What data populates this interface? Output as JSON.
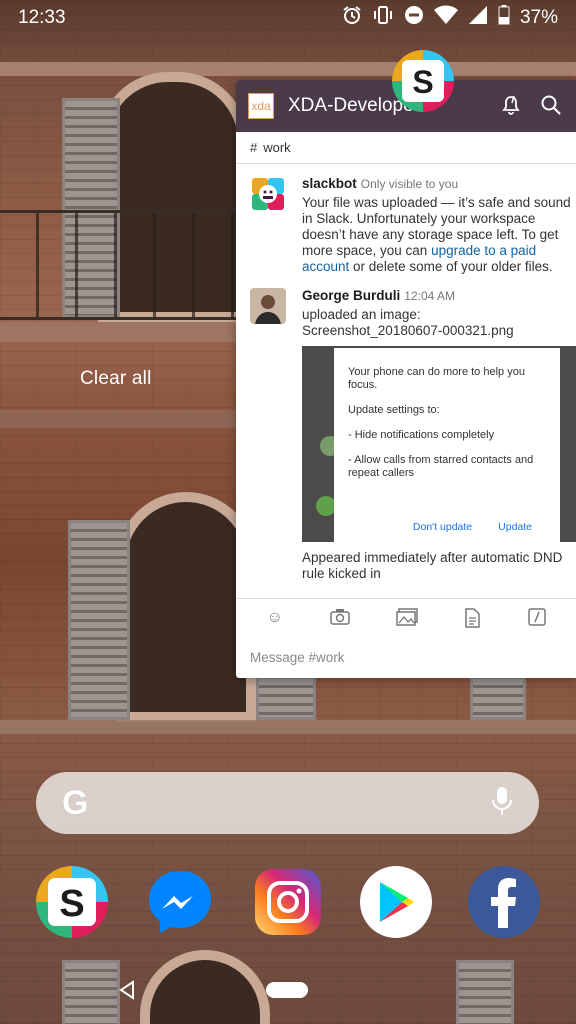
{
  "status_bar": {
    "time": "12:33",
    "battery": "37%",
    "icons": [
      "alarm-icon",
      "vibrate-icon",
      "dnd-icon",
      "wifi-icon",
      "signal-icon",
      "battery-icon"
    ]
  },
  "recents": {
    "clear_all_label": "Clear all"
  },
  "slack_card": {
    "workspace_logo": "xda",
    "workspace_name": "XDA-Developers",
    "channel": "work",
    "messages": [
      {
        "author": "slackbot",
        "meta": "Only visible to you",
        "text_before_link": "Your file was uploaded — it’s safe and sound in Slack. Unfortunately your workspace doesn’t have any storage space left. To get more space, you can ",
        "link": "upgrade to a paid account",
        "text_after_link": " or delete some of your older files."
      },
      {
        "author": "George Burduli",
        "time": "12:04 AM",
        "line1": "uploaded an image:",
        "filename": "Screenshot_20180607-000321.png",
        "caption": "Appeared immediately after automatic DND rule kicked in"
      }
    ],
    "screenshot_dialog": {
      "text1": "Your phone can do more to help you focus.",
      "text2": "Update settings to:",
      "text3": "- Hide notifications completely",
      "text4": "- Allow calls from starred contacts and repeat callers",
      "btn_dont": "Don't update",
      "btn_update": "Update"
    },
    "composer_placeholder": "Message #work"
  },
  "search_bar": {
    "logo": "G"
  },
  "dock": {
    "apps": [
      "Slack",
      "Messenger",
      "Instagram",
      "Play Store",
      "Facebook"
    ]
  },
  "colors": {
    "slack_header": "#4a3a4a",
    "link": "#1264a3",
    "facebook": "#3b5998",
    "messenger": "#0084ff"
  }
}
